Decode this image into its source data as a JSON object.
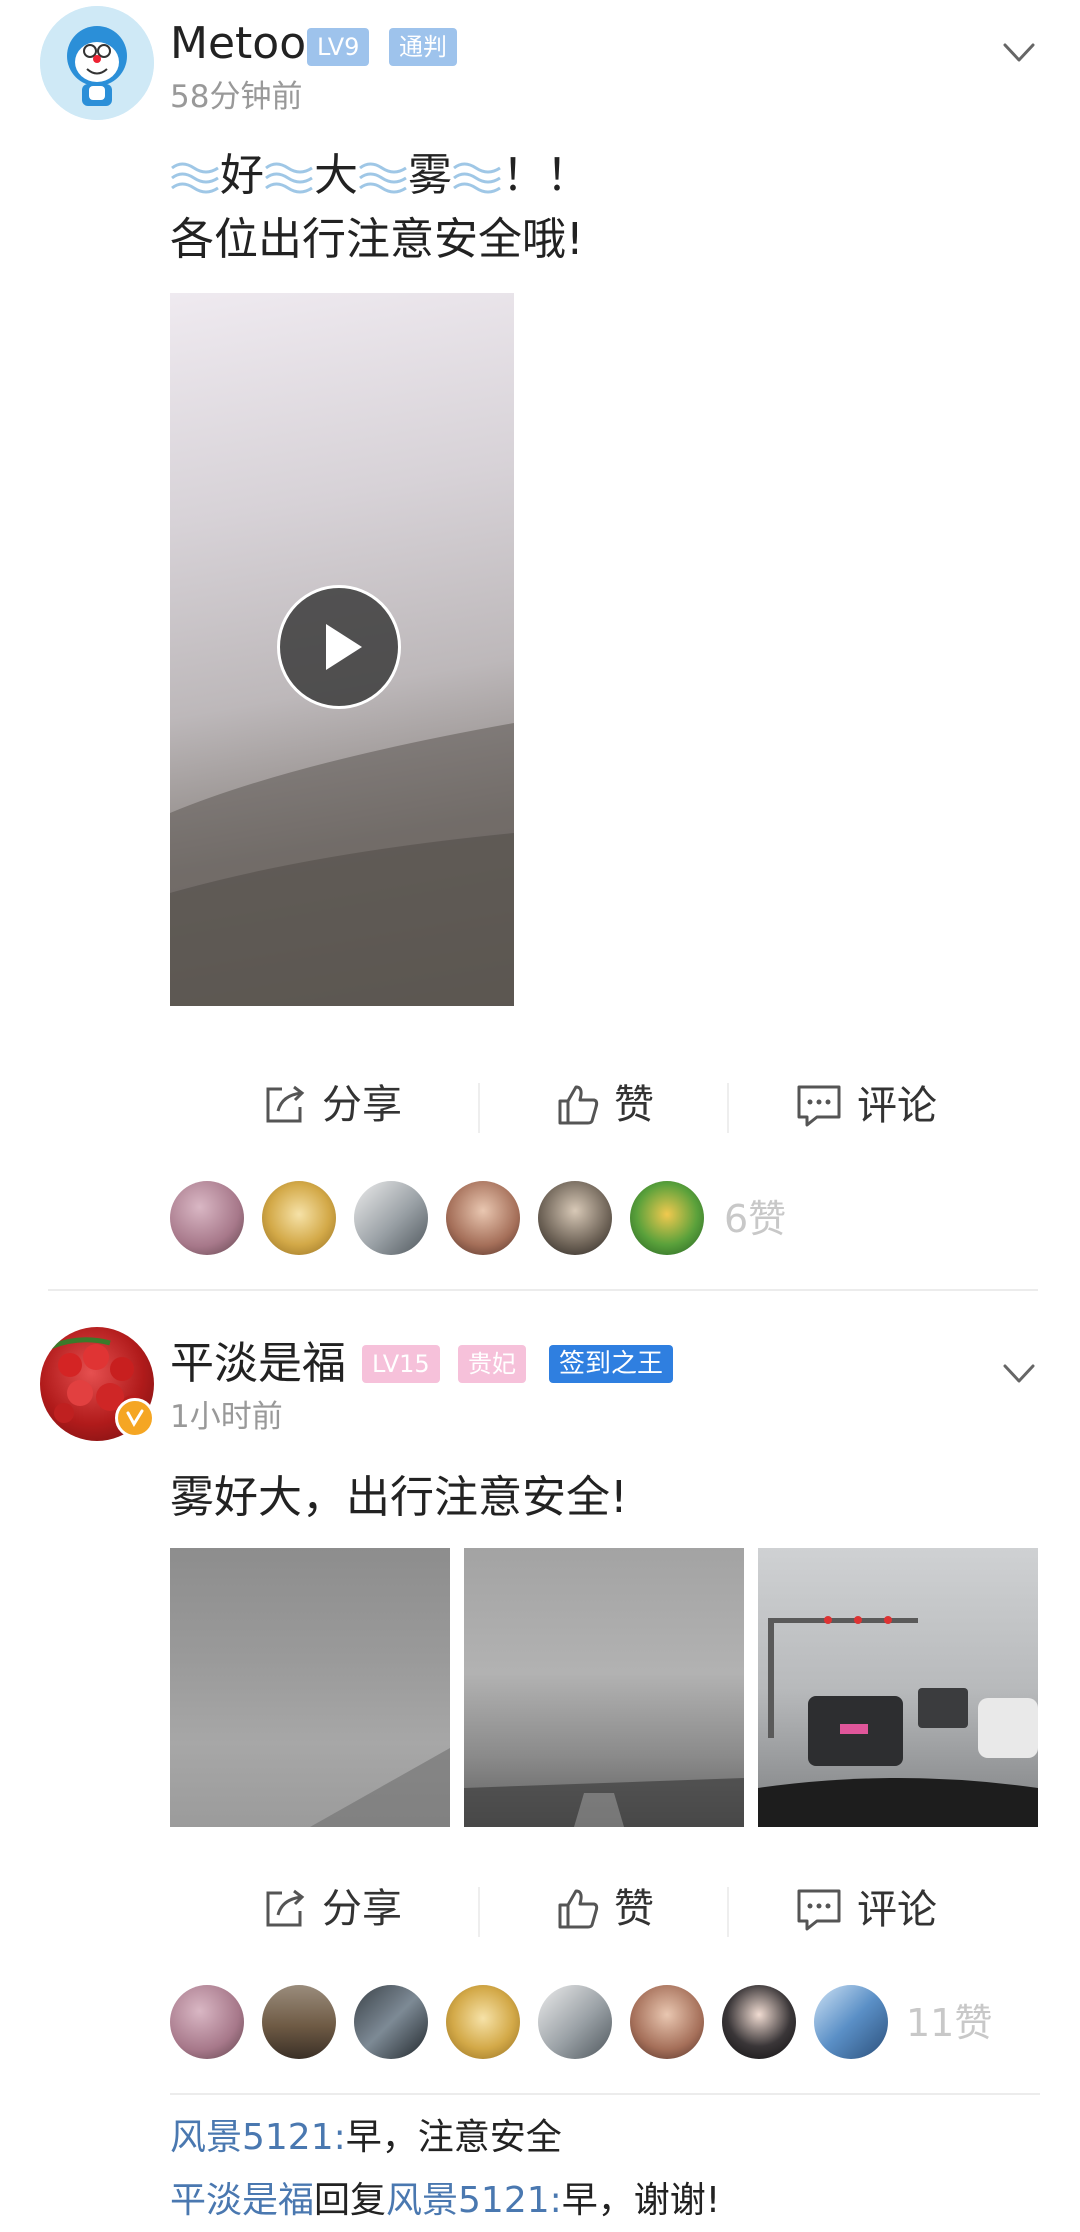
{
  "colors": {
    "username": "#222222",
    "time": "#999999",
    "link": "#4a78b0",
    "badge_level_blue": "#9ec3ec",
    "badge_level_pink": "#f6c1da",
    "badge_sign_king": "#2f7fe0",
    "likes_count": "#c8c8c8"
  },
  "post1": {
    "username": "Metoo",
    "badges": [
      "LV9",
      "通判"
    ],
    "time": "58分钟前",
    "text_line1": "好大雾！！",
    "text_line1_chars": [
      "好",
      "大",
      "雾",
      "！",
      "！"
    ],
    "text_line2": "各位出行注意安全哦!",
    "video": {
      "has_play_button": true
    },
    "actions": {
      "share": "分享",
      "like": "赞",
      "comment": "评论"
    },
    "likes_count": "6赞",
    "liker_count_shown": 6
  },
  "post2": {
    "username": "平淡是福",
    "badges": [
      "LV15",
      "贵妃",
      "签到之王"
    ],
    "time": "1小时前",
    "text": "雾好大，出行注意安全!",
    "images_count": 3,
    "actions": {
      "share": "分享",
      "like": "赞",
      "comment": "评论"
    },
    "likes_count": "11赞",
    "liker_count_shown": 8,
    "comments": [
      {
        "name": "风景5121",
        "sep": ":",
        "text": "早，注意安全"
      },
      {
        "name": "平淡是福",
        "mid": "回复",
        "reply_to": "风景5121",
        "sep": ":",
        "text": "早，谢谢!"
      }
    ]
  }
}
